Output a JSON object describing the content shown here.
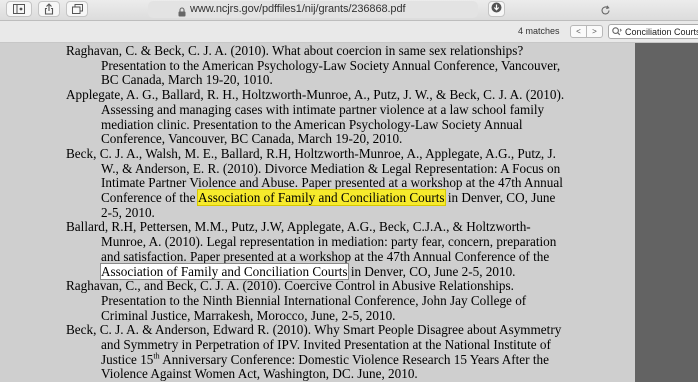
{
  "browser": {
    "url": "www.ncjrs.gov/pdffiles1/nij/grants/236868.pdf",
    "icons": [
      "sidebar-icon",
      "share-icon",
      "tabs-icon",
      "lock-icon",
      "reload-icon",
      "download-icon"
    ]
  },
  "find": {
    "count": "4 matches",
    "query": "Conciliation Courts",
    "prev": "<",
    "next": ">"
  },
  "references": [
    {
      "pre": "Raghavan, C. & Beck, C. J. A. (2010). What about coercion in same sex relationships? Presentation to the American Psychology-Law Society Annual Conference, Vancouver, BC Canada, March 19-20, 1010."
    },
    {
      "pre": "Applegate, A. G., Ballard, R. H., Holtzworth-Munroe, A., Putz, J. W., & Beck, C. J. A. (2010). Assessing and managing cases with intimate partner violence at a law school family mediation clinic. Presentation to the American Psychology-Law Society Annual Conference, Vancouver, BC Canada, March 19-20, 2010."
    },
    {
      "pre": "Beck, C. J. A., Walsh, M. E., Ballard, R.H, Holtzworth-Munroe, A., Applegate, A.G., Putz, J. W., & Anderson, E. R. (2010). Divorce Mediation & Legal Representation: A Focus on Intimate Partner Violence and Abuse. Paper presented at a workshop at the 47th Annual Conference of the ",
      "highlight": "Association of Family and Conciliation Courts",
      "post": " in Denver, CO, June 2-5, 2010."
    },
    {
      "pre": "Ballard, R.H, Pettersen, M.M., Putz, J.W, Applegate, A.G., Beck, C.J.A., & Holtzworth-Munroe, A. (2010). Legal representation in mediation: party fear, concern, preparation and satisfaction. Paper presented at a workshop at the 47th Annual Conference of the ",
      "highlight": "Association of Family and Conciliation Courts",
      "post": " in Denver, CO, June 2-5, 2010."
    },
    {
      "pre": "Raghavan, C., and Beck, C. J. A. (2010). Coercive Control in Abusive Relationships. Presentation to the Ninth Biennial International Conference, John Jay College of Criminal Justice, Marrakesh, Morocco, June, 2-5, 2010."
    },
    {
      "pre": "Beck, C. J. A. & Anderson, Edward R. (2010). Why Smart People Disagree about Asymmetry and Symmetry in Perpetration of IPV. Invited Presentation at the National Institute of Justice 15",
      "sup": "th",
      "post": " Anniversary Conference: Domestic Violence Research 15 Years After the Violence Against Women Act, Washington, DC.  June, 2010."
    }
  ]
}
